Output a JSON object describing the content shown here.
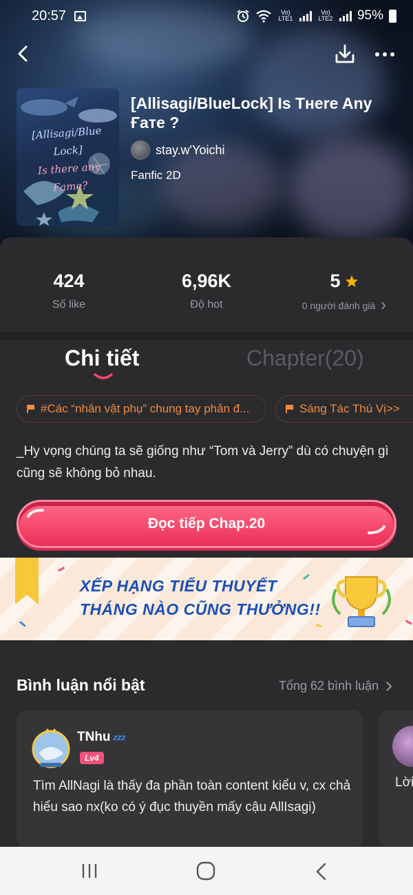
{
  "status_bar": {
    "time": "20:57",
    "sim1_label": "Vo) LTE1",
    "sim2_label": "Vo) LTE2",
    "battery": "95%",
    "icons": [
      "gallery-icon",
      "alarm-icon",
      "wifi-icon",
      "signal-icon",
      "battery-icon"
    ]
  },
  "top_bar": {
    "icons": [
      "back-arrow-icon",
      "download-icon",
      "more-icon"
    ]
  },
  "story": {
    "title": "[Allisagi/BlueLock] Is Tнere Any Ғaтe ?",
    "author": "stay.w'Yoichi",
    "genre": "Fanfic 2D",
    "cover_line1": "[Allisagi/Blue Lock]",
    "cover_line2": "Is there any Ғaтe?"
  },
  "stats": [
    {
      "value": "424",
      "label": "Số like"
    },
    {
      "value": "6,96K",
      "label": "Độ hot"
    },
    {
      "value": "5",
      "label": "0 người đánh giá"
    }
  ],
  "tabs": {
    "detail": "Chi tiết",
    "chapter": "Chapter(20)"
  },
  "tags": [
    "#Các “nhân vật phụ” chung tay phản đ...",
    "Sáng Tác Thú Vị>>"
  ],
  "description": "_Hy vọng chúng ta sẽ giống như “Tom và Jerry” dù có chuyện gì cũng sẽ không bỏ nhau.",
  "read_button": "Đọc tiếp Chap.20",
  "banner": {
    "line1": "XẾP HẠNG TIỂU THUYẾT",
    "line2": "THÁNG NÀO CŨNG THƯỞNG!!"
  },
  "comments_section": {
    "title": "Bình luận nổi bật",
    "total": "Tổng 62 bình luận",
    "comments": [
      {
        "user": "TNhu",
        "status": "zzz",
        "level": "Lv4",
        "text": "Tìm AllNagi là thấy đa phần toàn content kiểu v, cx chả hiểu sao nx(ko có ý đục thuyền mấy cậu AllIsagi)"
      },
      {
        "text": "Lời"
      }
    ]
  },
  "colors": {
    "accent": "#f4476b",
    "tag": "#f08a3e",
    "star": "#f5b400",
    "background": "#2b2b2e"
  }
}
